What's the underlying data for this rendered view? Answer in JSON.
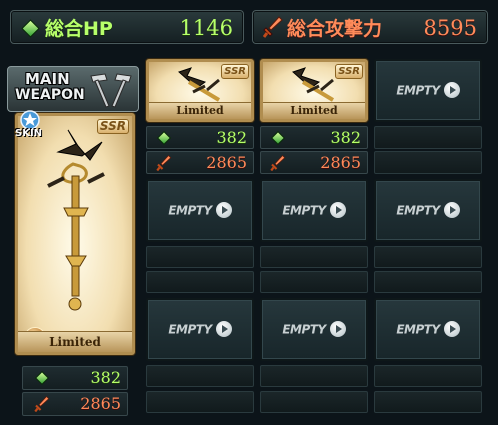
{
  "header": {
    "hp_label": "総合HP",
    "hp_value": "1146",
    "attack_label": "総合攻撃力",
    "attack_value": "8595"
  },
  "main_weapon": {
    "title_line1": "MAIN",
    "title_line2": "WEAPON",
    "skin_label": "SKIN",
    "rarity": "SSR",
    "tag": "Limited",
    "hp": "382",
    "attack": "2865"
  },
  "grid": {
    "weapons": [
      {
        "rarity": "SSR",
        "tag": "Limited",
        "hp": "382",
        "attack": "2865"
      },
      {
        "rarity": "SSR",
        "tag": "Limited",
        "hp": "382",
        "attack": "2865"
      }
    ],
    "empty_label": "EMPTY"
  },
  "colors": {
    "hp": "#b7ff6a",
    "attack": "#ff8b5a",
    "frame_gold": "#b08d4f"
  },
  "icons": [
    "hp-gem-icon",
    "attack-sword-icon",
    "hammer-icon",
    "play-icon",
    "star-skin-icon"
  ]
}
